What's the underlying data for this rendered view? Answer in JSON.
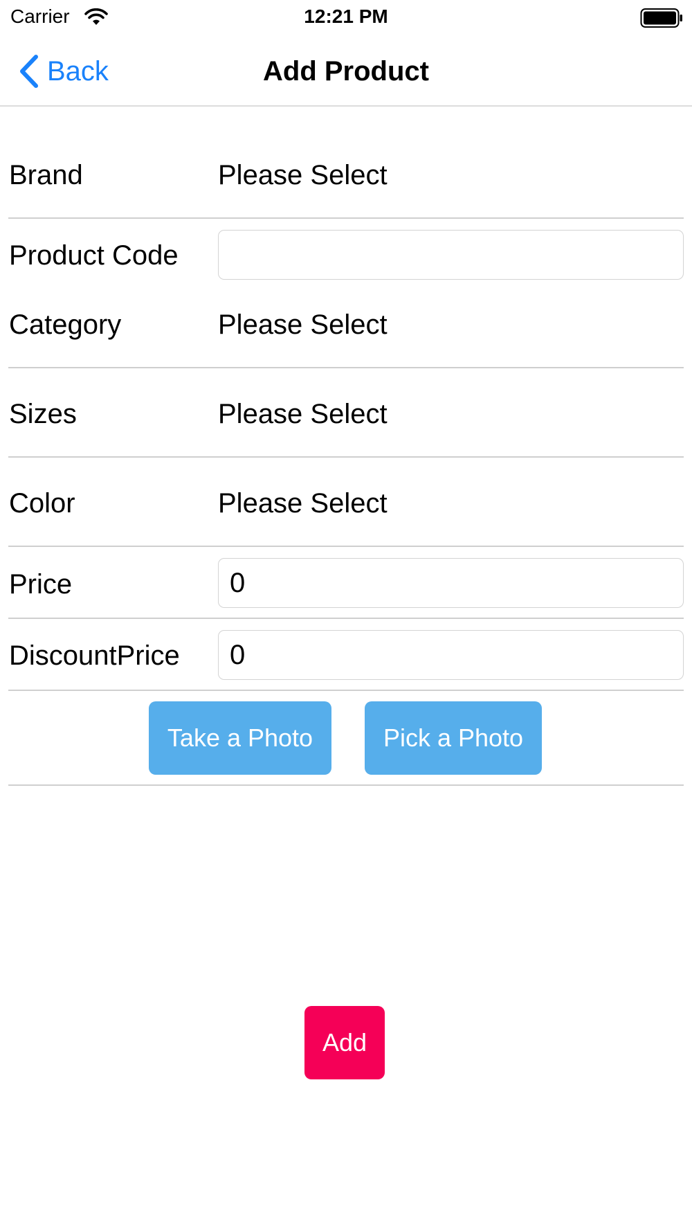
{
  "status_bar": {
    "carrier": "Carrier",
    "time": "12:21 PM",
    "wifi_icon": "wifi-icon",
    "battery_icon": "battery-icon"
  },
  "nav": {
    "back_label": "Back",
    "back_icon": "chevron-left-icon",
    "title": "Add Product"
  },
  "form": {
    "brand": {
      "label": "Brand",
      "value": "Please Select"
    },
    "product_code": {
      "label": "Product Code",
      "value": ""
    },
    "category": {
      "label": "Category",
      "value": "Please Select"
    },
    "sizes": {
      "label": "Sizes",
      "value": "Please Select"
    },
    "color": {
      "label": "Color",
      "value": "Please Select"
    },
    "price": {
      "label": "Price",
      "value": "0"
    },
    "discount_price": {
      "label": "DiscountPrice",
      "value": "0"
    }
  },
  "buttons": {
    "take_photo": "Take a Photo",
    "pick_photo": "Pick a Photo",
    "add": "Add"
  },
  "colors": {
    "accent_blue": "#1a82fb",
    "photo_button": "#56aeeb",
    "add_button": "#f50057"
  }
}
